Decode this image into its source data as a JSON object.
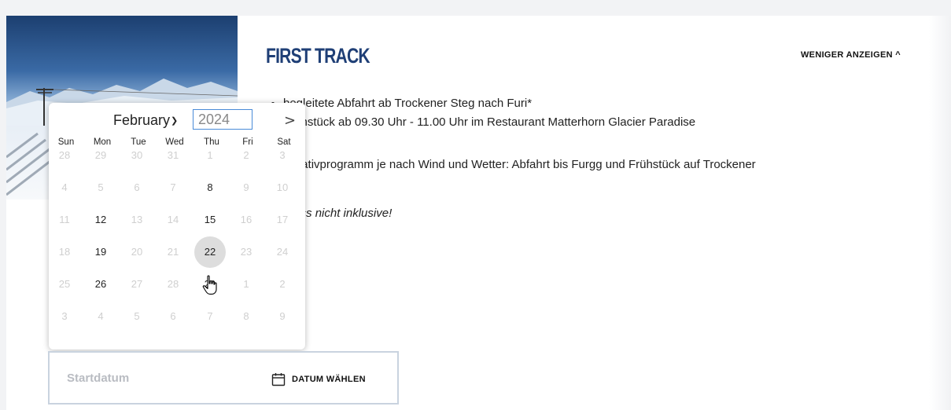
{
  "card": {
    "title": "FIRST TRACK",
    "toggle_label": "WENIGER ANZEIGEN ^",
    "bullets": [
      "begleitete Abfahrt ab Trockener Steg nach Furi*",
      "Frühstück ab 09.30 Uhr  - 11.00 Uhr im Restaurant Matterhorn Glacier Paradise"
    ],
    "alt_program": "Alternativprogramm je nach Wind und Wetter: Abfahrt bis Furgg und Frühstück auf Trockener",
    "note": "Skipass nicht inklusive!"
  },
  "datepicker": {
    "month": "February",
    "year": "2024",
    "next_symbol": ">",
    "weekdays": [
      "Sun",
      "Mon",
      "Tue",
      "Wed",
      "Thu",
      "Fri",
      "Sat"
    ],
    "weeks": [
      [
        {
          "d": "28",
          "en": false
        },
        {
          "d": "29",
          "en": false
        },
        {
          "d": "30",
          "en": false
        },
        {
          "d": "31",
          "en": false
        },
        {
          "d": "1",
          "en": false
        },
        {
          "d": "2",
          "en": false
        },
        {
          "d": "3",
          "en": false
        }
      ],
      [
        {
          "d": "4",
          "en": false
        },
        {
          "d": "5",
          "en": false
        },
        {
          "d": "6",
          "en": false
        },
        {
          "d": "7",
          "en": false
        },
        {
          "d": "8",
          "en": true
        },
        {
          "d": "9",
          "en": false
        },
        {
          "d": "10",
          "en": false
        }
      ],
      [
        {
          "d": "11",
          "en": false
        },
        {
          "d": "12",
          "en": true
        },
        {
          "d": "13",
          "en": false
        },
        {
          "d": "14",
          "en": false
        },
        {
          "d": "15",
          "en": true
        },
        {
          "d": "16",
          "en": false
        },
        {
          "d": "17",
          "en": false
        }
      ],
      [
        {
          "d": "18",
          "en": false
        },
        {
          "d": "19",
          "en": true
        },
        {
          "d": "20",
          "en": false
        },
        {
          "d": "21",
          "en": false
        },
        {
          "d": "22",
          "en": true,
          "hover": true
        },
        {
          "d": "23",
          "en": false
        },
        {
          "d": "24",
          "en": false
        }
      ],
      [
        {
          "d": "25",
          "en": false
        },
        {
          "d": "26",
          "en": true
        },
        {
          "d": "27",
          "en": false
        },
        {
          "d": "28",
          "en": false
        },
        {
          "d": "29",
          "en": true
        },
        {
          "d": "1",
          "en": false
        },
        {
          "d": "2",
          "en": false
        }
      ],
      [
        {
          "d": "3",
          "en": false
        },
        {
          "d": "4",
          "en": false
        },
        {
          "d": "5",
          "en": false
        },
        {
          "d": "6",
          "en": false
        },
        {
          "d": "7",
          "en": false
        },
        {
          "d": "8",
          "en": false
        },
        {
          "d": "9",
          "en": false
        }
      ]
    ]
  },
  "date_field": {
    "placeholder": "Startdatum",
    "button_label": "DATUM WÄHLEN",
    "button_icon": "calendar-icon"
  }
}
